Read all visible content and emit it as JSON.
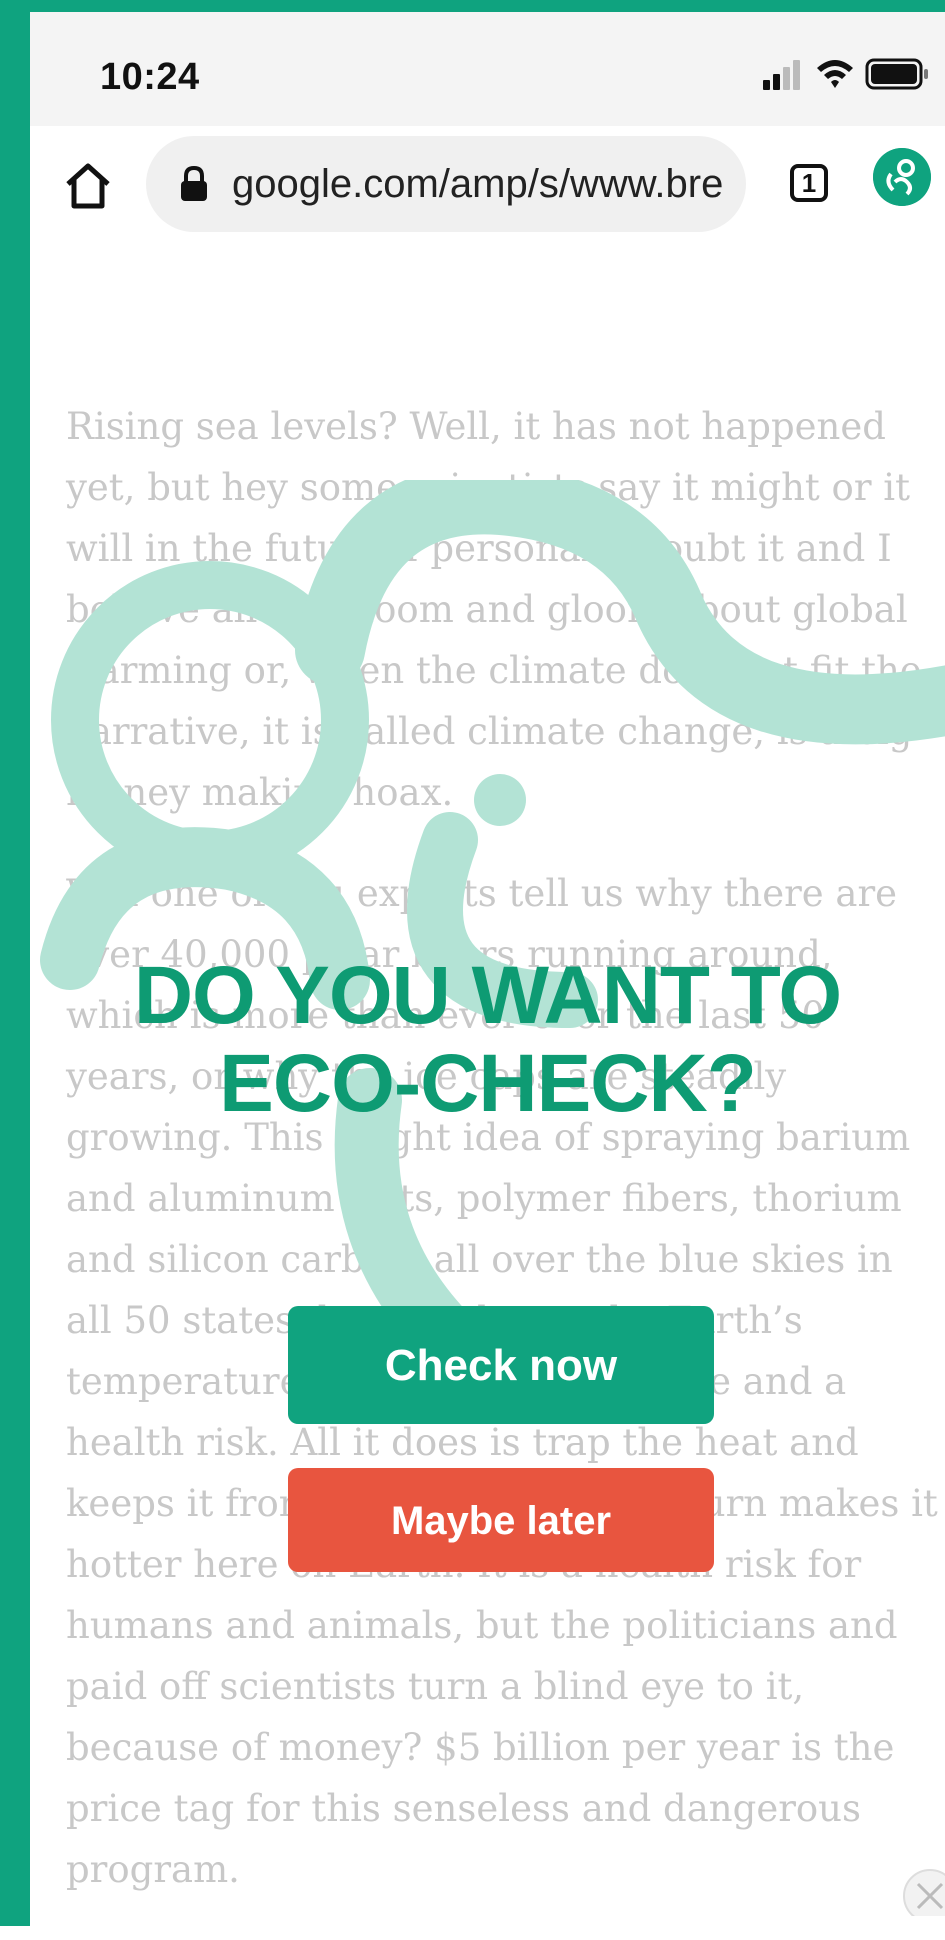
{
  "status_bar": {
    "time": "10:24"
  },
  "browser": {
    "url": "google.com/amp/s/www.bre",
    "tab_count": "1"
  },
  "article": {
    "paragraphs": [
      "Rising sea levels? Well, it has not happened yet, but hey some scientists say it might or it will in the future. I personally doubt it and I believe all this doom and gloom about global warming or, when the climate does not fit the narrative, it is called climate change, is a big money making hoax.",
      "Will one of you experts tell us why there are over 40,000 polar bears running around, which is more than ever over the last 50 years, or why the ice caps are steadily growing. This bright idea of spraying barium and aluminum salts, polymer fibers, thorium and silicon carbide all over the blue skies in all 50 states does not lower the Earth’s temperature, it is a toxic substance and a health risk. All it does is trap the heat and keeps it from escaping, which in turn makes it hotter here on Earth. It is a health risk for humans and animals, but the politicians and paid off scientists turn a blind eye to it, because of money? $5 billion per year is the price tag for this senseless and dangerous program."
    ]
  },
  "overlay": {
    "headline_line1": "DO YOU WANT TO",
    "headline_line2": "ECO-CHECK?",
    "check_now_label": "Check now",
    "maybe_later_label": "Maybe later"
  },
  "colors": {
    "brand_green": "#0fa37f",
    "headline_green": "#0e9b73",
    "watermark_mint": "#b3e3d5",
    "decline_red": "#e8553f"
  }
}
